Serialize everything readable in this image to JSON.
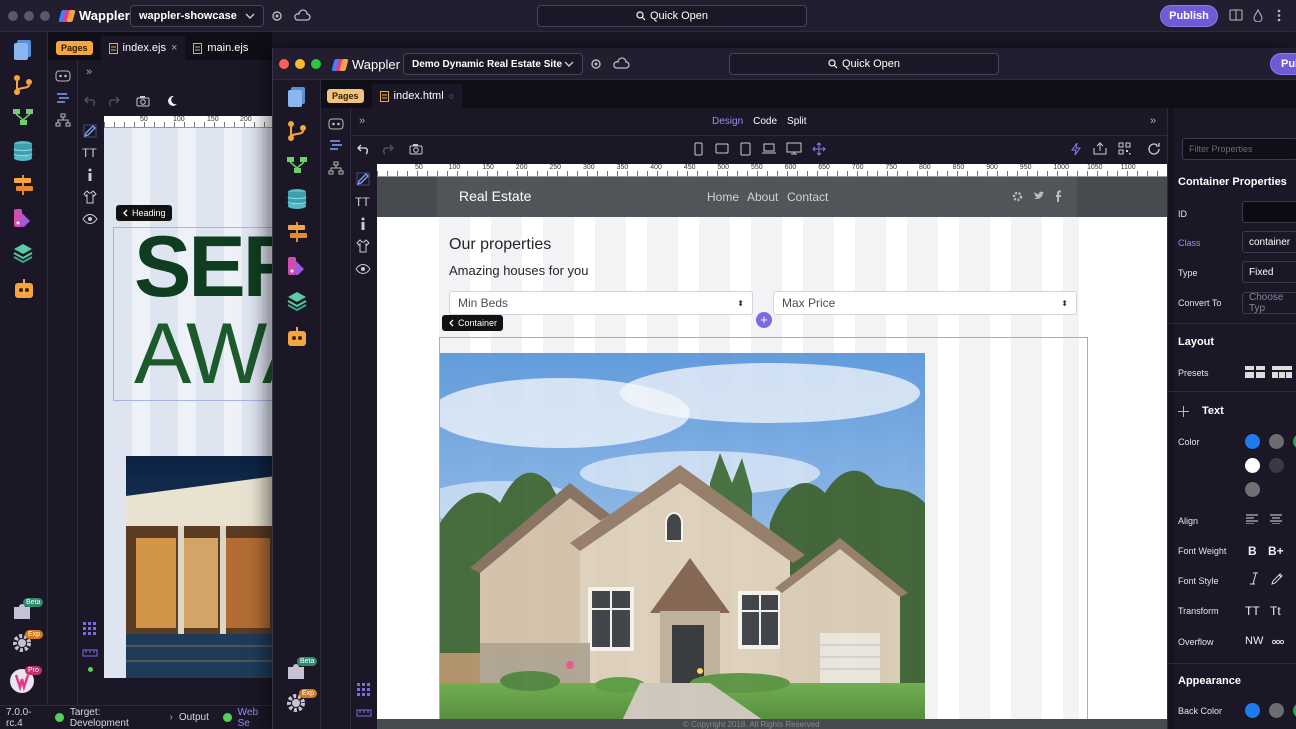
{
  "back_window": {
    "app_name": "Wappler",
    "project": "wappler-showcase",
    "quick_open": "Quick Open",
    "publish": "Publish",
    "pages_label": "Pages",
    "tabs": [
      {
        "label": "index.ejs",
        "active": true,
        "close": "×"
      },
      {
        "label": "main.ejs",
        "active": false
      }
    ],
    "ruler_ticks": [
      "50",
      "100",
      "150",
      "200"
    ],
    "heading_tag": "Heading",
    "hero_line1": "SER",
    "hero_line2": "AWA",
    "rail_badges": {
      "beta": "Beta",
      "exp": "Exp",
      "pro": "Pro"
    }
  },
  "status_bar": {
    "version": "7.0.0-rc.4",
    "target_label": "Target: Development",
    "output_label": "Output",
    "web_server_label": "Web Se"
  },
  "front_window": {
    "app_name": "Wappler",
    "project": "Demo Dynamic Real Estate Site",
    "quick_open": "Quick Open",
    "publish": "Publ",
    "pages_label": "Pages",
    "tab": {
      "label": "index.html",
      "modified": "○"
    },
    "view_modes": [
      {
        "label": "Design",
        "active": true
      },
      {
        "label": "Code",
        "active": false
      },
      {
        "label": "Split",
        "active": false
      }
    ],
    "ruler_ticks": [
      "50",
      "100",
      "150",
      "200",
      "250",
      "300",
      "350",
      "400",
      "450",
      "500",
      "550",
      "600",
      "650",
      "700",
      "750",
      "800",
      "850",
      "900",
      "950",
      "1000",
      "1050",
      "1100"
    ],
    "rail_badges": {
      "beta": "Beta",
      "exp": "Exp"
    }
  },
  "site_preview": {
    "brand": "Real Estate",
    "nav": [
      "Home",
      "About",
      "Contact"
    ],
    "social_icons": [
      "gear-social-icon",
      "twitter-icon",
      "facebook-icon"
    ],
    "heading": "Our properties",
    "subheading": "Amazing houses for you",
    "select_min_beds": "Min Beds",
    "select_max_price": "Max Price",
    "container_tag": "Container",
    "footer": "© Copyright 2018. All Rights Reserved"
  },
  "properties_panel": {
    "filter_placeholder": "Filter Properties",
    "title": "Container Properties",
    "fields": [
      {
        "label": "ID",
        "value": "",
        "highlight": false
      },
      {
        "label": "Class",
        "value": "container",
        "highlight": true
      },
      {
        "label": "Type",
        "value": "Fixed",
        "highlight": false
      },
      {
        "label": "Convert To",
        "value": "Choose Typ",
        "highlight": false
      }
    ],
    "layout_section": "Layout",
    "presets_label": "Presets",
    "text_section": "Text",
    "color_label": "Color",
    "text_colors": [
      "#1f7cf0",
      "#6c6c72",
      "#27a84a",
      "#ffffff",
      "#3a3a40",
      "#707076"
    ],
    "align_label": "Align",
    "font_weight_label": "Font Weight",
    "font_weight_values": [
      "B",
      "B+"
    ],
    "font_style_label": "Font Style",
    "transform_label": "Transform",
    "transform_values": [
      "TT",
      "Tt"
    ],
    "overflow_label": "Overflow",
    "overflow_value": "NW",
    "appearance_section": "Appearance",
    "back_color_label": "Back Color",
    "back_colors": [
      "#1f7cf0",
      "#6c6c72",
      "#27a84a"
    ]
  }
}
